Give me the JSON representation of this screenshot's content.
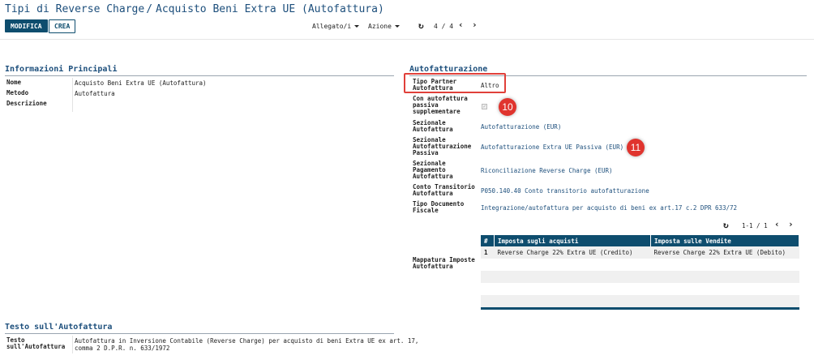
{
  "breadcrumb": {
    "parent": "Tipi di Reverse Charge",
    "separator": "/",
    "current": "Acquisto Beni Extra UE (Autofattura)"
  },
  "toolbar": {
    "edit_label": "MODIFICA",
    "create_label": "CREA",
    "attachments_label": "Allegato/i",
    "action_label": "Azione",
    "pager": "4 / 4"
  },
  "main_info": {
    "title": "Informazioni Principali",
    "name_label": "Nome",
    "name_value": "Acquisto Beni Extra UE (Autofattura)",
    "method_label": "Metodo",
    "method_value": "Autofattura",
    "description_label": "Descrizione",
    "description_value": ""
  },
  "self_invoice": {
    "title": "Autofatturazione",
    "partner_type_label": "Tipo Partner Autofattura",
    "partner_type_value": "Altro",
    "supplementary_label": "Con autofattura passiva supplementare",
    "supplementary_checked": true,
    "journal_label": "Sezionale Autofattura",
    "journal_value": "Autofatturazione (EUR)",
    "passive_journal_label": "Sezionale Autofatturazione Passiva",
    "passive_journal_value": "Autofatturazione Extra UE Passiva (EUR)",
    "payment_journal_label": "Sezionale Pagamento Autofattura",
    "payment_journal_value": "Riconciliazione Reverse Charge (EUR)",
    "transit_account_label": "Conto Transitorio Autofattura",
    "transit_account_value": "P050.140.40 Conto transitorio autofatturazione",
    "document_type_label": "Tipo Documento Fiscale",
    "document_type_value": "Integrazione/autofattura per acquisto di beni ex art.17 c.2 DPR 633/72",
    "tax_mapping_label": "Mappatura Imposte Autofattura",
    "table_pager": "1-1 / 1",
    "table": {
      "headers": [
        "#",
        "Imposta sugli acquisti",
        "Imposta sulle Vendite"
      ],
      "rows": [
        [
          "1",
          "Reverse Charge 22% Extra UE (Credito)",
          "Reverse Charge 22% Extra UE (Debito)"
        ]
      ]
    }
  },
  "invoice_text": {
    "title": "Testo sull'Autofattura",
    "text_label": "Testo sull'Autofattura",
    "text_line1": "Autofattura in Inversione Contabile (Reverse Charge) per acquisto di beni Extra UE ex art. 17,",
    "text_line2": "comma 2 D.P.R. n. 633/1972"
  },
  "annotations": {
    "badge_10": "10",
    "badge_11": "11"
  },
  "colors": {
    "brand": "#0e4d6e",
    "link": "#1d4f7c",
    "highlight": "#e0403a"
  },
  "icons": [
    "caret-down-icon",
    "refresh-icon",
    "chevron-left-icon",
    "chevron-right-icon",
    "checkbox-icon"
  ]
}
